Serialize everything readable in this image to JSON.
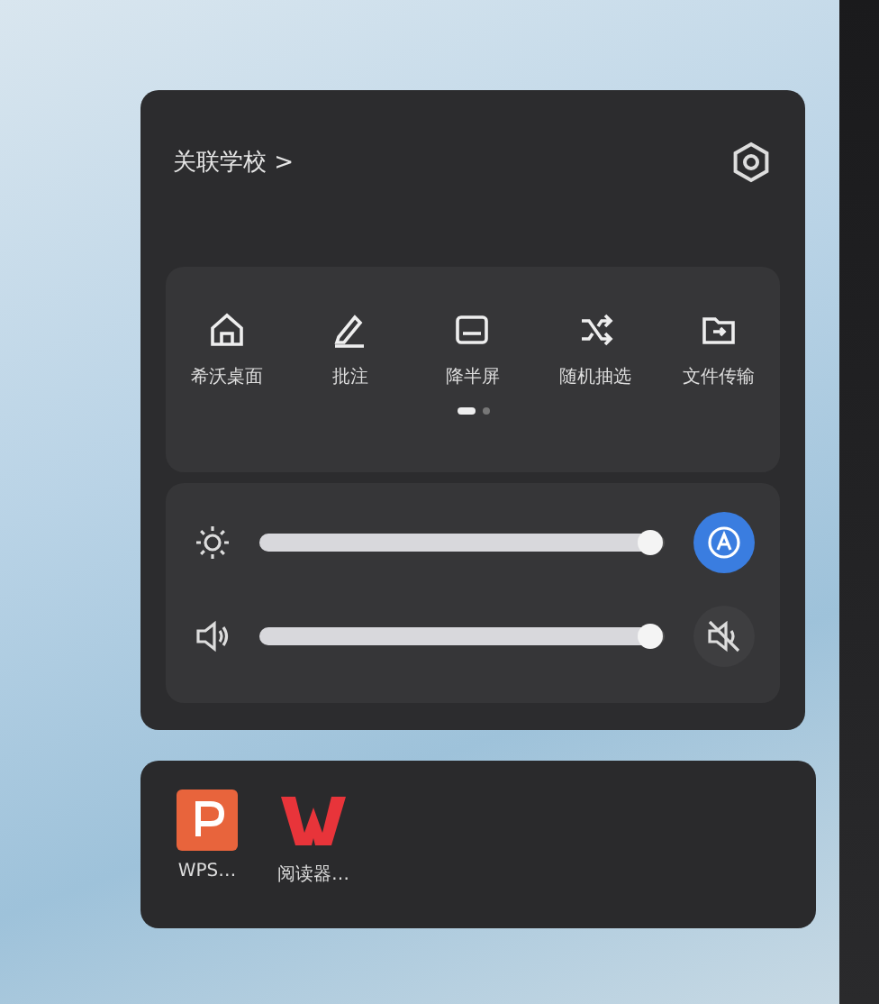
{
  "panel": {
    "title": "关联学校",
    "chevron": ">"
  },
  "shortcuts": [
    {
      "label": "希沃桌面",
      "kind": "home"
    },
    {
      "label": "批注",
      "kind": "pen"
    },
    {
      "label": "降半屏",
      "kind": "halfscreen"
    },
    {
      "label": "随机抽选",
      "kind": "shuffle"
    },
    {
      "label": "文件传输",
      "kind": "transfer"
    }
  ],
  "pager": [
    {
      "selected": true
    },
    {
      "selected": false
    }
  ],
  "sliders": [
    {
      "kind": "brightness",
      "level": 0.98
    },
    {
      "kind": "volume",
      "level": 0.98
    }
  ],
  "auto_brightness": {
    "on": true
  },
  "mute": {
    "on": false
  },
  "apps": [
    {
      "label": "WPS…",
      "kind": "slides"
    },
    {
      "label": "阅读器…",
      "kind": "wps"
    }
  ]
}
